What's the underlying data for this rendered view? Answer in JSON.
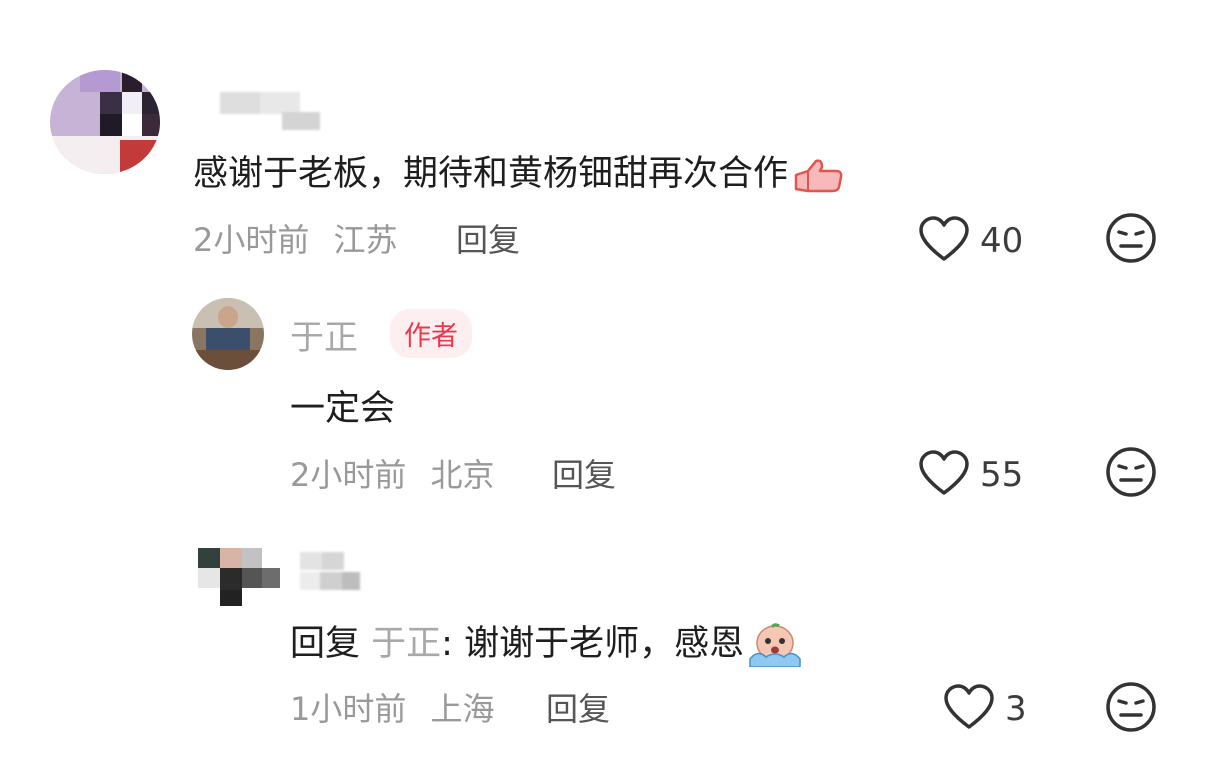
{
  "comments": [
    {
      "text": "感谢于老板，期待和黄杨钿甜再次合作",
      "emoji": "thumbs-up",
      "time": "2小时前",
      "location": "江苏",
      "reply_label": "回复",
      "likes": "40"
    },
    {
      "username": "于正",
      "badge": "作者",
      "text": "一定会",
      "time": "2小时前",
      "location": "北京",
      "reply_label": "回复",
      "likes": "55"
    },
    {
      "reply_prefix": "回复",
      "reply_to": "于正",
      "colon": ":",
      "text": " 谢谢于老师，感恩",
      "emoji": "crying-face",
      "time": "1小时前",
      "location": "上海",
      "reply_label": "回复",
      "likes": "3"
    }
  ],
  "colors": {
    "badge_text": "#e8394d",
    "badge_bg": "#fdeef0",
    "meta_text": "#999999"
  }
}
